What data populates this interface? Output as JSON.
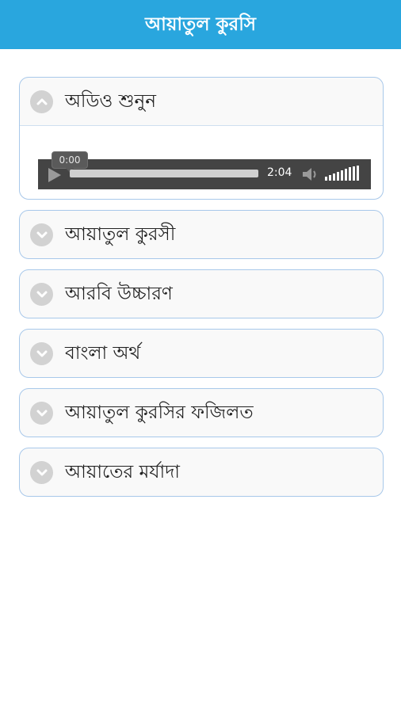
{
  "header": {
    "title": "আয়াতুল কুরসি",
    "color": "#29a6de"
  },
  "sections": [
    {
      "label": "অডিও শুনুন",
      "expanded": true,
      "icon": "chevron-up-icon"
    },
    {
      "label": "আয়াতুল কুরসী",
      "expanded": false,
      "icon": "chevron-down-icon"
    },
    {
      "label": "আরবি উচ্চারণ",
      "expanded": false,
      "icon": "chevron-down-icon"
    },
    {
      "label": "বাংলা অর্থ",
      "expanded": false,
      "icon": "chevron-down-icon"
    },
    {
      "label": "আয়াতুল কুরসির ফজিলত",
      "expanded": false,
      "icon": "chevron-down-icon"
    },
    {
      "label": "আয়াতের মর্যাদা",
      "expanded": false,
      "icon": "chevron-down-icon"
    }
  ],
  "player": {
    "current_time": "0:00",
    "duration": "2:04",
    "progress": 0,
    "volume_level": 1.0
  }
}
